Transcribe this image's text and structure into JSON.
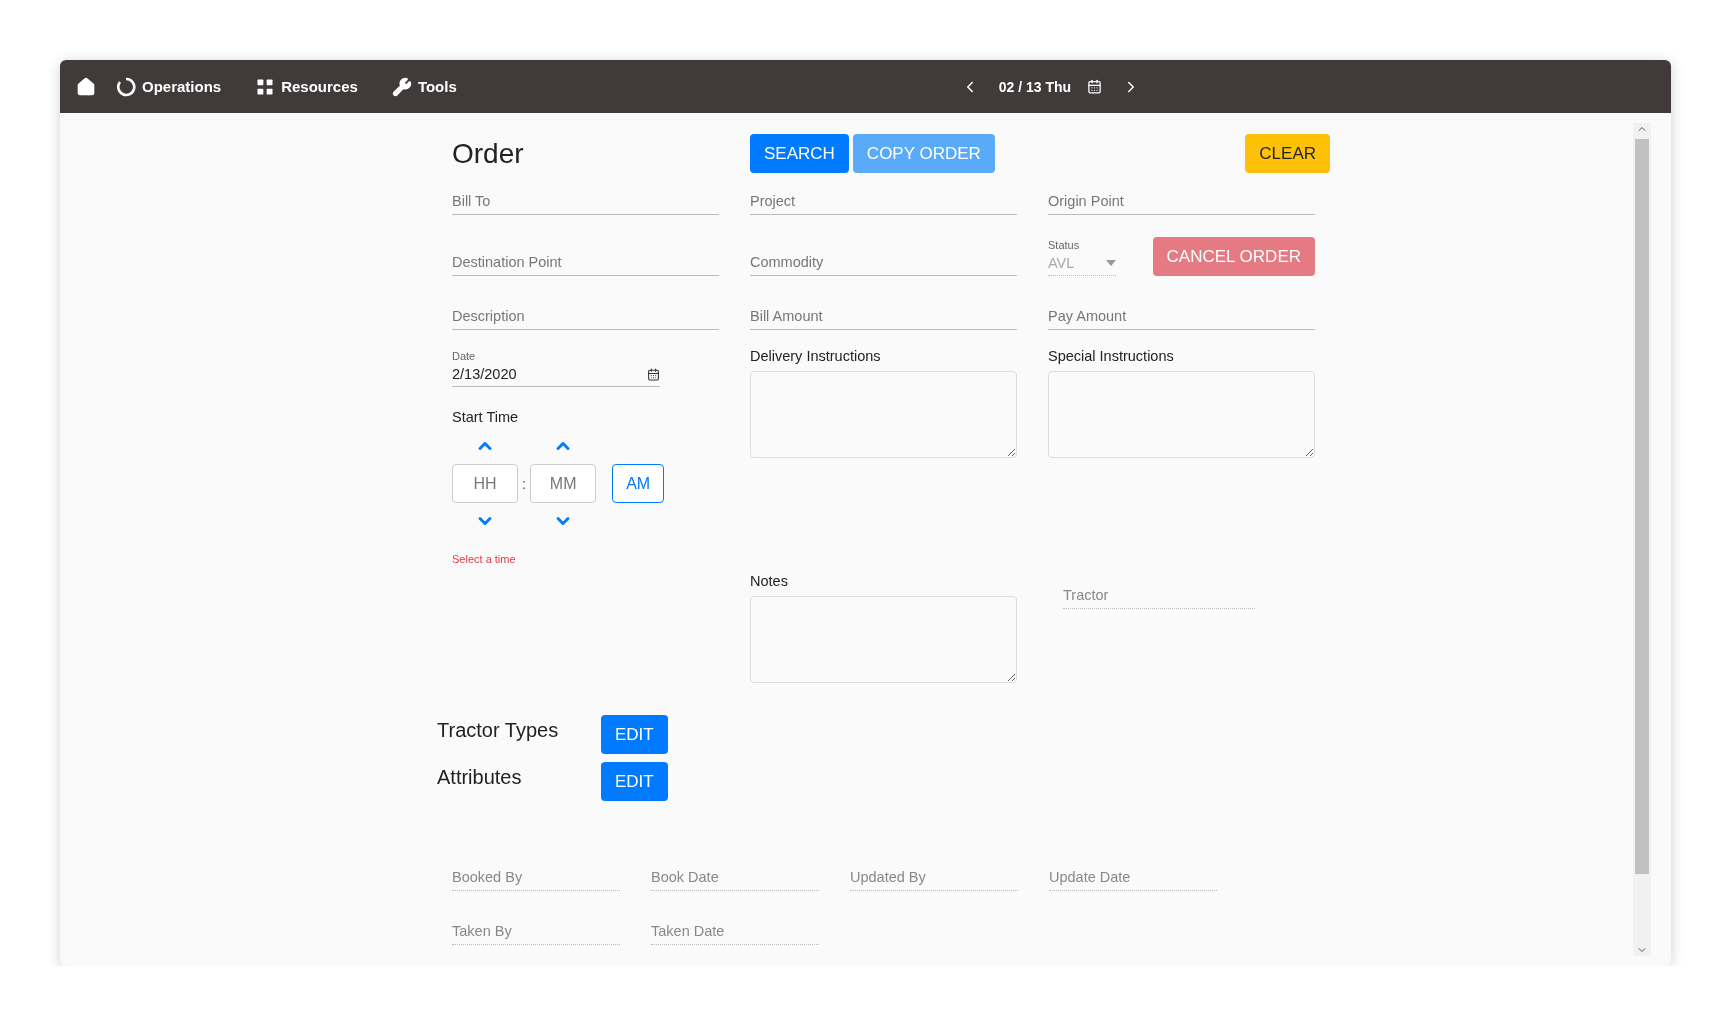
{
  "navbar": {
    "items": [
      {
        "label": "Operations",
        "kind": "ring"
      },
      {
        "label": "Resources",
        "kind": "grid"
      },
      {
        "label": "Tools",
        "kind": "wrench"
      }
    ],
    "date": "02 / 13 Thu"
  },
  "toolbar": {
    "title": "Order",
    "buttons": [
      {
        "label": "SEARCH",
        "kind": "primary"
      },
      {
        "label": "COPY ORDER",
        "kind": "light"
      },
      {
        "label": "CLEAR",
        "kind": "warning"
      }
    ]
  },
  "form_rows": [
    [
      {
        "kind": "text",
        "placeholder": "Bill To"
      },
      {
        "kind": "text",
        "placeholder": "Project"
      },
      {
        "kind": "text",
        "placeholder": "Origin Point"
      }
    ],
    [
      {
        "kind": "text",
        "placeholder": "Destination Point"
      },
      {
        "kind": "text",
        "placeholder": "Commodity"
      },
      {
        "kind": "status",
        "label": "Status",
        "value": "AVL",
        "disabled": true,
        "action": "CANCEL ORDER"
      }
    ],
    [
      {
        "kind": "text",
        "placeholder": "Description"
      },
      {
        "kind": "text",
        "placeholder": "Bill Amount"
      },
      {
        "kind": "text",
        "placeholder": "Pay Amount"
      }
    ]
  ],
  "date": {
    "label": "Date",
    "value": "2/13/2020"
  },
  "start_time": {
    "label": "Start Time",
    "hour_placeholder": "HH",
    "separator": ":",
    "minute_placeholder": "MM",
    "period": "AM",
    "error": "Select a time"
  },
  "textareas": [
    {
      "label": "Delivery Instructions"
    },
    {
      "label": "Special Instructions"
    },
    {
      "label": "Notes"
    }
  ],
  "tractor": {
    "placeholder": "Tractor",
    "disabled": true
  },
  "sections": [
    {
      "title": "Tractor Types",
      "button": "EDIT"
    },
    {
      "title": "Attributes",
      "button": "EDIT"
    }
  ],
  "audit_fields": [
    {
      "placeholder": "Booked By",
      "disabled": true
    },
    {
      "placeholder": "Book Date",
      "disabled": true
    },
    {
      "placeholder": "Updated By",
      "disabled": true
    },
    {
      "placeholder": "Update Date",
      "disabled": true
    },
    {
      "placeholder": "Taken By",
      "disabled": true
    },
    {
      "placeholder": "Taken Date",
      "disabled": true
    }
  ]
}
